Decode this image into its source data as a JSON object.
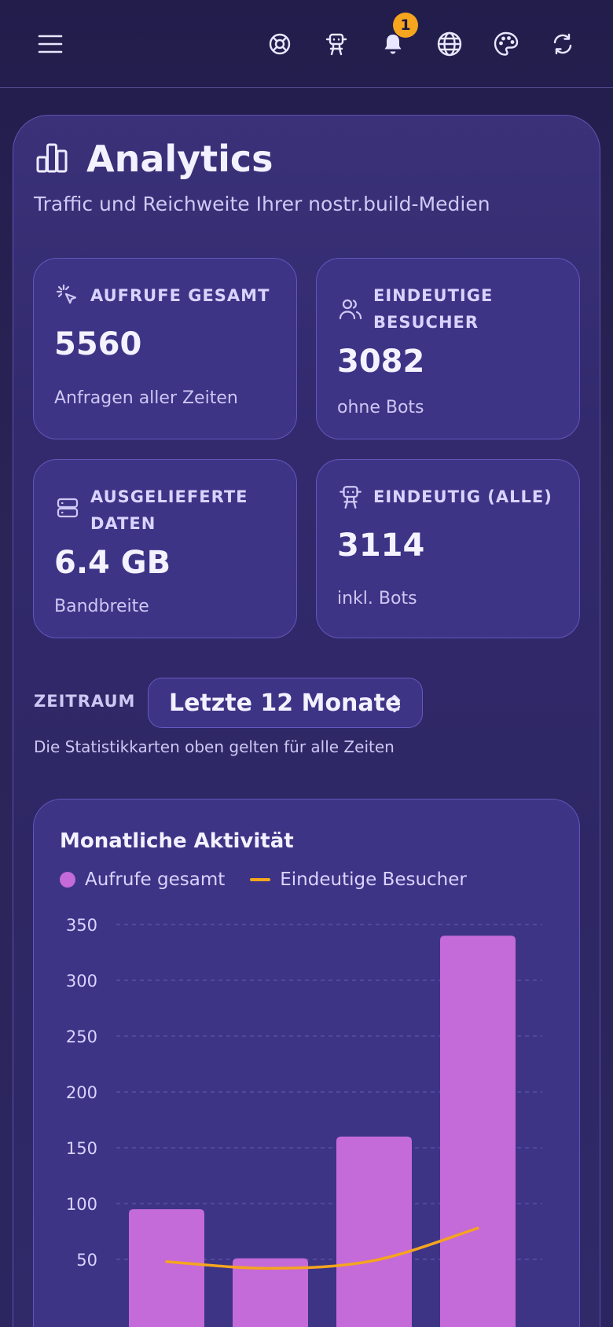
{
  "header": {
    "icons": [
      "menu-icon",
      "lifebuoy-icon",
      "bot-icon",
      "bell-icon",
      "globe-icon",
      "palette-icon",
      "refresh-icon"
    ],
    "notification_count": "1"
  },
  "page": {
    "title": "Analytics",
    "subtitle": "Traffic und Reichweite Ihrer nostr.build-Medien"
  },
  "stats": {
    "total_views": {
      "label": "AUFRUFE GESAMT",
      "value": "5560",
      "sub": "Anfragen aller Zeiten"
    },
    "unique_visitors": {
      "label_line1": "EINDEUTIGE",
      "label_line2": "BESUCHER",
      "value": "3082",
      "sub": "ohne Bots"
    },
    "data_delivered": {
      "label_line1": "AUSGELIEFERTE",
      "label_line2": "DATEN",
      "value": "6.4 GB",
      "sub": "Bandbreite"
    },
    "unique_all": {
      "label": "EINDEUTIG (ALLE)",
      "value": "3114",
      "sub": "inkl. Bots"
    }
  },
  "range": {
    "label": "ZEITRAUM",
    "selected": "Letzte 12 Monate",
    "note": "Die Statistikkarten oben gelten für alle Zeiten"
  },
  "colors": {
    "bar": "#c46ad9",
    "line": "#f5a51e",
    "accent": "#f5a51e"
  },
  "chart_data": {
    "type": "bar",
    "title": "Monatliche Aktivität",
    "ylim": [
      0,
      350
    ],
    "yticks": [
      "350",
      "300",
      "250",
      "200",
      "150",
      "100",
      "50"
    ],
    "grid": true,
    "legend_position": "top-left",
    "series": [
      {
        "name": "Aufrufe gesamt",
        "type": "bar",
        "values": [
          95,
          51,
          160,
          340
        ]
      },
      {
        "name": "Eindeutige Besucher",
        "type": "line",
        "values": [
          48,
          42,
          49,
          78
        ]
      }
    ]
  }
}
